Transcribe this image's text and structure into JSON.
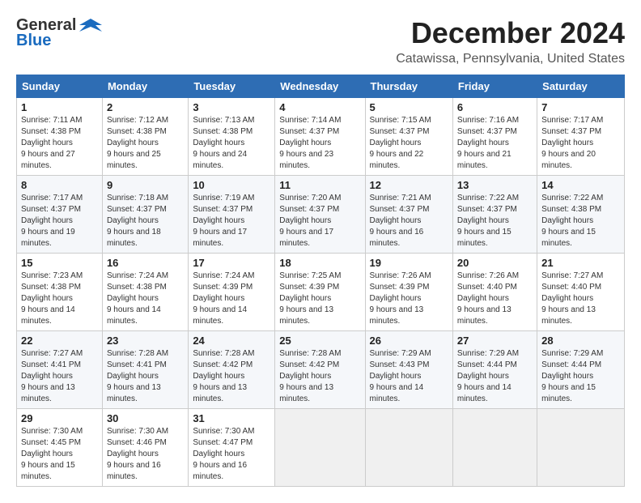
{
  "header": {
    "logo_general": "General",
    "logo_blue": "Blue",
    "month_title": "December 2024",
    "location": "Catawissa, Pennsylvania, United States"
  },
  "calendar": {
    "days_of_week": [
      "Sunday",
      "Monday",
      "Tuesday",
      "Wednesday",
      "Thursday",
      "Friday",
      "Saturday"
    ],
    "weeks": [
      [
        null,
        null,
        null,
        null,
        null,
        null,
        null
      ]
    ],
    "cells": [
      {
        "day": null,
        "date": ""
      },
      {
        "day": null,
        "date": ""
      },
      {
        "day": null,
        "date": ""
      },
      {
        "day": null,
        "date": ""
      },
      {
        "day": null,
        "date": ""
      },
      {
        "day": null,
        "date": ""
      },
      {
        "day": null,
        "date": ""
      }
    ]
  },
  "rows": [
    [
      {
        "date": "1",
        "sunrise": "7:11 AM",
        "sunset": "4:38 PM",
        "daylight": "9 hours and 27 minutes."
      },
      {
        "date": "2",
        "sunrise": "7:12 AM",
        "sunset": "4:38 PM",
        "daylight": "9 hours and 25 minutes."
      },
      {
        "date": "3",
        "sunrise": "7:13 AM",
        "sunset": "4:38 PM",
        "daylight": "9 hours and 24 minutes."
      },
      {
        "date": "4",
        "sunrise": "7:14 AM",
        "sunset": "4:37 PM",
        "daylight": "9 hours and 23 minutes."
      },
      {
        "date": "5",
        "sunrise": "7:15 AM",
        "sunset": "4:37 PM",
        "daylight": "9 hours and 22 minutes."
      },
      {
        "date": "6",
        "sunrise": "7:16 AM",
        "sunset": "4:37 PM",
        "daylight": "9 hours and 21 minutes."
      },
      {
        "date": "7",
        "sunrise": "7:17 AM",
        "sunset": "4:37 PM",
        "daylight": "9 hours and 20 minutes."
      }
    ],
    [
      {
        "date": "8",
        "sunrise": "7:17 AM",
        "sunset": "4:37 PM",
        "daylight": "9 hours and 19 minutes."
      },
      {
        "date": "9",
        "sunrise": "7:18 AM",
        "sunset": "4:37 PM",
        "daylight": "9 hours and 18 minutes."
      },
      {
        "date": "10",
        "sunrise": "7:19 AM",
        "sunset": "4:37 PM",
        "daylight": "9 hours and 17 minutes."
      },
      {
        "date": "11",
        "sunrise": "7:20 AM",
        "sunset": "4:37 PM",
        "daylight": "9 hours and 17 minutes."
      },
      {
        "date": "12",
        "sunrise": "7:21 AM",
        "sunset": "4:37 PM",
        "daylight": "9 hours and 16 minutes."
      },
      {
        "date": "13",
        "sunrise": "7:22 AM",
        "sunset": "4:37 PM",
        "daylight": "9 hours and 15 minutes."
      },
      {
        "date": "14",
        "sunrise": "7:22 AM",
        "sunset": "4:38 PM",
        "daylight": "9 hours and 15 minutes."
      }
    ],
    [
      {
        "date": "15",
        "sunrise": "7:23 AM",
        "sunset": "4:38 PM",
        "daylight": "9 hours and 14 minutes."
      },
      {
        "date": "16",
        "sunrise": "7:24 AM",
        "sunset": "4:38 PM",
        "daylight": "9 hours and 14 minutes."
      },
      {
        "date": "17",
        "sunrise": "7:24 AM",
        "sunset": "4:39 PM",
        "daylight": "9 hours and 14 minutes."
      },
      {
        "date": "18",
        "sunrise": "7:25 AM",
        "sunset": "4:39 PM",
        "daylight": "9 hours and 13 minutes."
      },
      {
        "date": "19",
        "sunrise": "7:26 AM",
        "sunset": "4:39 PM",
        "daylight": "9 hours and 13 minutes."
      },
      {
        "date": "20",
        "sunrise": "7:26 AM",
        "sunset": "4:40 PM",
        "daylight": "9 hours and 13 minutes."
      },
      {
        "date": "21",
        "sunrise": "7:27 AM",
        "sunset": "4:40 PM",
        "daylight": "9 hours and 13 minutes."
      }
    ],
    [
      {
        "date": "22",
        "sunrise": "7:27 AM",
        "sunset": "4:41 PM",
        "daylight": "9 hours and 13 minutes."
      },
      {
        "date": "23",
        "sunrise": "7:28 AM",
        "sunset": "4:41 PM",
        "daylight": "9 hours and 13 minutes."
      },
      {
        "date": "24",
        "sunrise": "7:28 AM",
        "sunset": "4:42 PM",
        "daylight": "9 hours and 13 minutes."
      },
      {
        "date": "25",
        "sunrise": "7:28 AM",
        "sunset": "4:42 PM",
        "daylight": "9 hours and 13 minutes."
      },
      {
        "date": "26",
        "sunrise": "7:29 AM",
        "sunset": "4:43 PM",
        "daylight": "9 hours and 14 minutes."
      },
      {
        "date": "27",
        "sunrise": "7:29 AM",
        "sunset": "4:44 PM",
        "daylight": "9 hours and 14 minutes."
      },
      {
        "date": "28",
        "sunrise": "7:29 AM",
        "sunset": "4:44 PM",
        "daylight": "9 hours and 15 minutes."
      }
    ],
    [
      {
        "date": "29",
        "sunrise": "7:30 AM",
        "sunset": "4:45 PM",
        "daylight": "9 hours and 15 minutes."
      },
      {
        "date": "30",
        "sunrise": "7:30 AM",
        "sunset": "4:46 PM",
        "daylight": "9 hours and 16 minutes."
      },
      {
        "date": "31",
        "sunrise": "7:30 AM",
        "sunset": "4:47 PM",
        "daylight": "9 hours and 16 minutes."
      },
      null,
      null,
      null,
      null
    ]
  ]
}
